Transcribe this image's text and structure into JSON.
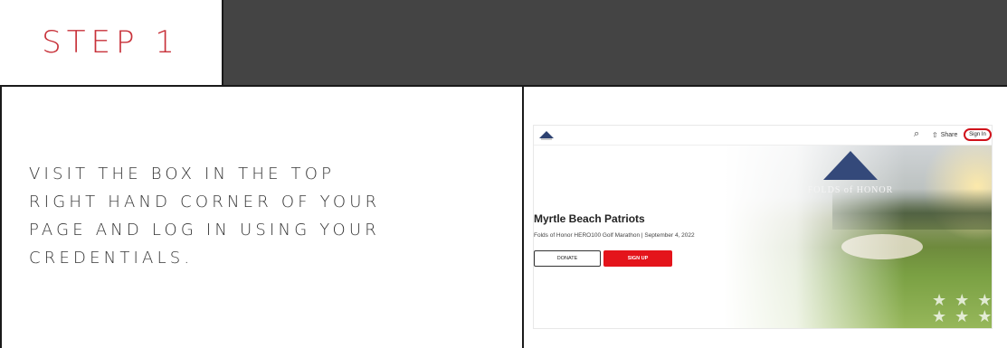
{
  "step": {
    "title": "STEP 1"
  },
  "instructions": {
    "lines": [
      "VISIT THE BOX IN THE TOP",
      "RIGHT HAND CORNER OF YOUR",
      "PAGE AND LOG IN USING YOUR",
      "CREDENTIALS."
    ]
  },
  "screenshot": {
    "nav": {
      "search_icon": "search-icon",
      "share_label": "Share",
      "signin_label": "Sign In"
    },
    "hero": {
      "brand_text": "FOLDS of HONOR",
      "title": "Myrtle Beach Patriots",
      "subtitle": "Folds of Honor HERO100 Golf Marathon | September 4, 2022",
      "donate_label": "DONATE",
      "signup_label": "SIGN UP",
      "stars": "★ ★ ★\n★ ★ ★"
    }
  },
  "colors": {
    "accent": "#c8323a",
    "signup": "#e4141b",
    "highlight_ring": "#d0121b"
  }
}
